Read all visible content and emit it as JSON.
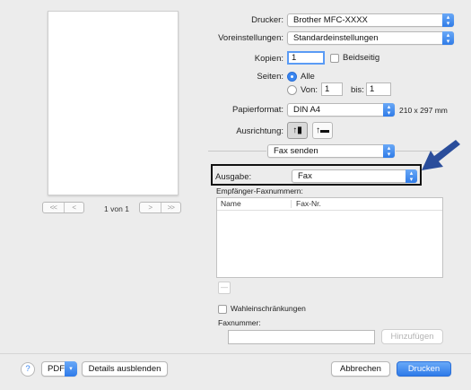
{
  "preview": {
    "page_count": "1 von 1",
    "nav_first_label": "<<",
    "nav_prev_label": "<",
    "nav_next_label": ">",
    "nav_last_label": ">>"
  },
  "printer": {
    "label": "Drucker:",
    "value": "Brother MFC-XXXX"
  },
  "presets": {
    "label": "Voreinstellungen:",
    "value": "Standardeinstellungen"
  },
  "copies": {
    "label": "Kopien:",
    "value": "1",
    "duplex_label": "Beidseitig",
    "duplex_checked": false
  },
  "pages": {
    "label": "Seiten:",
    "all_label": "Alle",
    "from_label": "Von:",
    "from_value": "1",
    "to_label": "bis:",
    "to_value": "1",
    "selected": "all"
  },
  "paper": {
    "label": "Papierformat:",
    "value": "DIN A4",
    "size_text": "210 x 297 mm"
  },
  "orientation": {
    "label": "Ausrichtung:",
    "selected": "portrait"
  },
  "section": {
    "value": "Fax senden"
  },
  "output": {
    "label": "Ausgabe:",
    "value": "Fax"
  },
  "recipients": {
    "label": "Empfänger-Faxnummern:",
    "columns": [
      "Name",
      "Fax-Nr."
    ],
    "rows": [],
    "remove_label": "—"
  },
  "dialing": {
    "restrictions_label": "Wahleinschränkungen",
    "restrictions_checked": false
  },
  "fax_number": {
    "label": "Faxnummer:",
    "value": "",
    "add_label": "Hinzufügen"
  },
  "footer": {
    "help_label": "?",
    "pdf_label": "PDF",
    "details_label": "Details ausblenden",
    "cancel_label": "Abbrechen",
    "print_label": "Drucken"
  },
  "colors": {
    "accent": "#2e7ae9",
    "callout_arrow": "#2a4d9b"
  },
  "icons": {
    "pdf_menu": "chevron-down-icon",
    "select": "up-down-chevrons-icon",
    "callout": "pointer-arrow-icon"
  }
}
